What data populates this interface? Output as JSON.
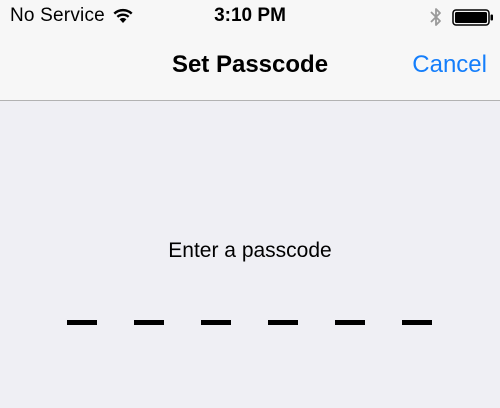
{
  "status_bar": {
    "carrier": "No Service",
    "time": "3:10 PM",
    "wifi_icon": "wifi-icon",
    "bluetooth_icon": "bluetooth-icon",
    "battery_icon": "battery-icon"
  },
  "nav": {
    "title": "Set Passcode",
    "cancel_label": "Cancel"
  },
  "passcode": {
    "prompt": "Enter a passcode",
    "digit_count": 6,
    "entered_count": 0
  },
  "colors": {
    "accent": "#147efb",
    "background": "#efeff4",
    "bar": "#f7f7f7"
  }
}
